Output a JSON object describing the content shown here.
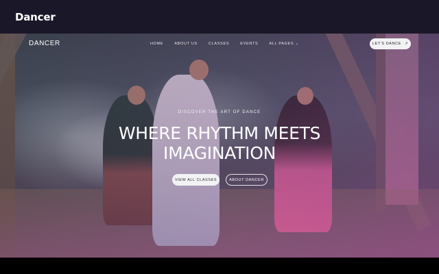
{
  "window": {
    "title": "Dancer"
  },
  "nav": {
    "logo": "DANCER",
    "links": [
      "HOME",
      "ABOUT US",
      "CLASSES",
      "EVENTS",
      "ALL PAGES ⌄"
    ],
    "cta_label": "LET'S DANCE",
    "cta_icon": "arrow-up-right-icon"
  },
  "hero": {
    "eyebrow": "DISCOVER THE ART OF DANCE",
    "headline_line1": "WHERE RHYTHM MEETS",
    "headline_line2": "IMAGINATION",
    "primary_button": "VIEW ALL CLASSES",
    "secondary_button": "ABOUT DANCER"
  },
  "colors": {
    "topbar_bg": "#1a1828",
    "button_bg": "#f2f2f4",
    "hero_tint": "#9a3c96"
  }
}
